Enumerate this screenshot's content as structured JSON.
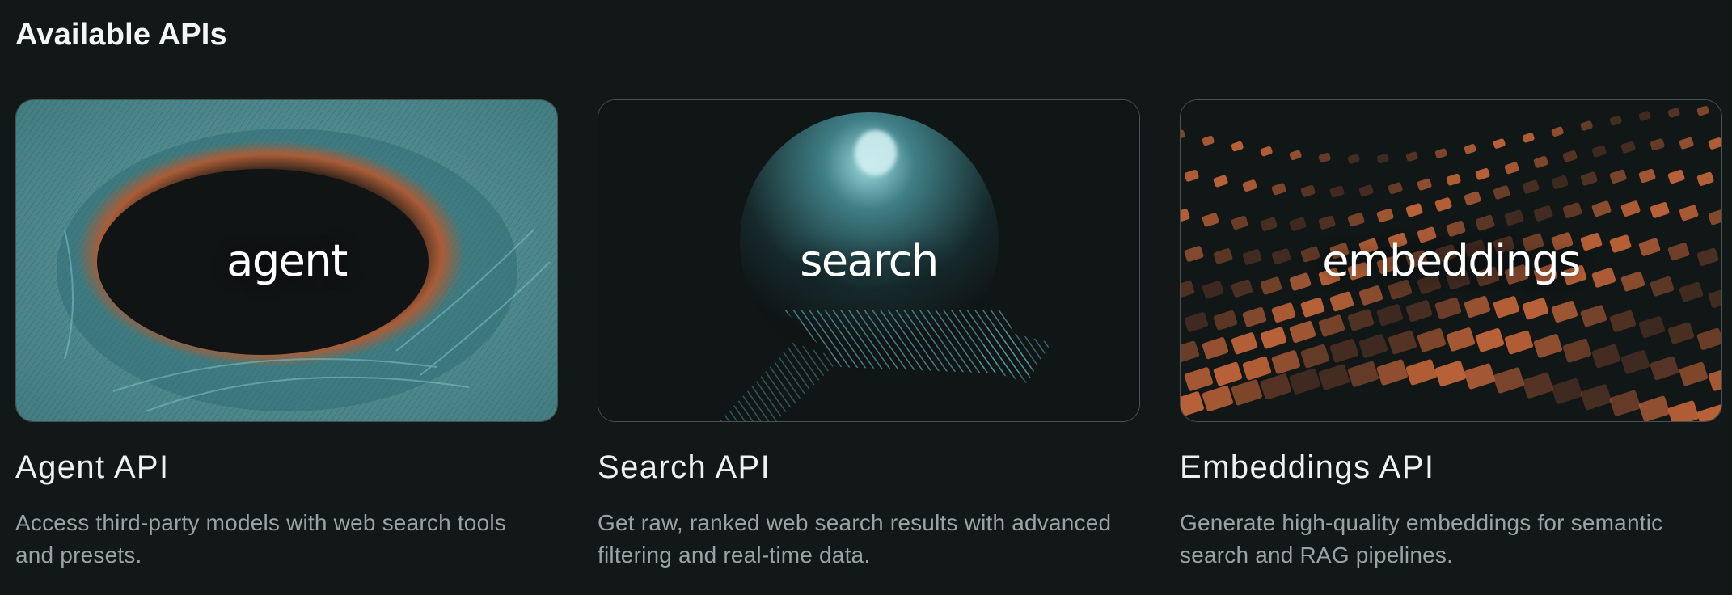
{
  "page": {
    "title": "Available APIs"
  },
  "colors": {
    "background": "#121718",
    "teal": "#5fb3bd",
    "copper": "#c2653a",
    "muted_text": "#9aa3a4"
  },
  "cards": [
    {
      "thumb_label": "agent",
      "title": "Agent API",
      "description": "Access third-party models with web search tools and presets."
    },
    {
      "thumb_label": "search",
      "title": "Search API",
      "description": "Get raw, ranked web search results with advanced filtering and real-time data."
    },
    {
      "thumb_label": "embeddings",
      "title": "Embeddings API",
      "description": "Generate high-quality embeddings for semantic search and RAG pipelines."
    }
  ]
}
